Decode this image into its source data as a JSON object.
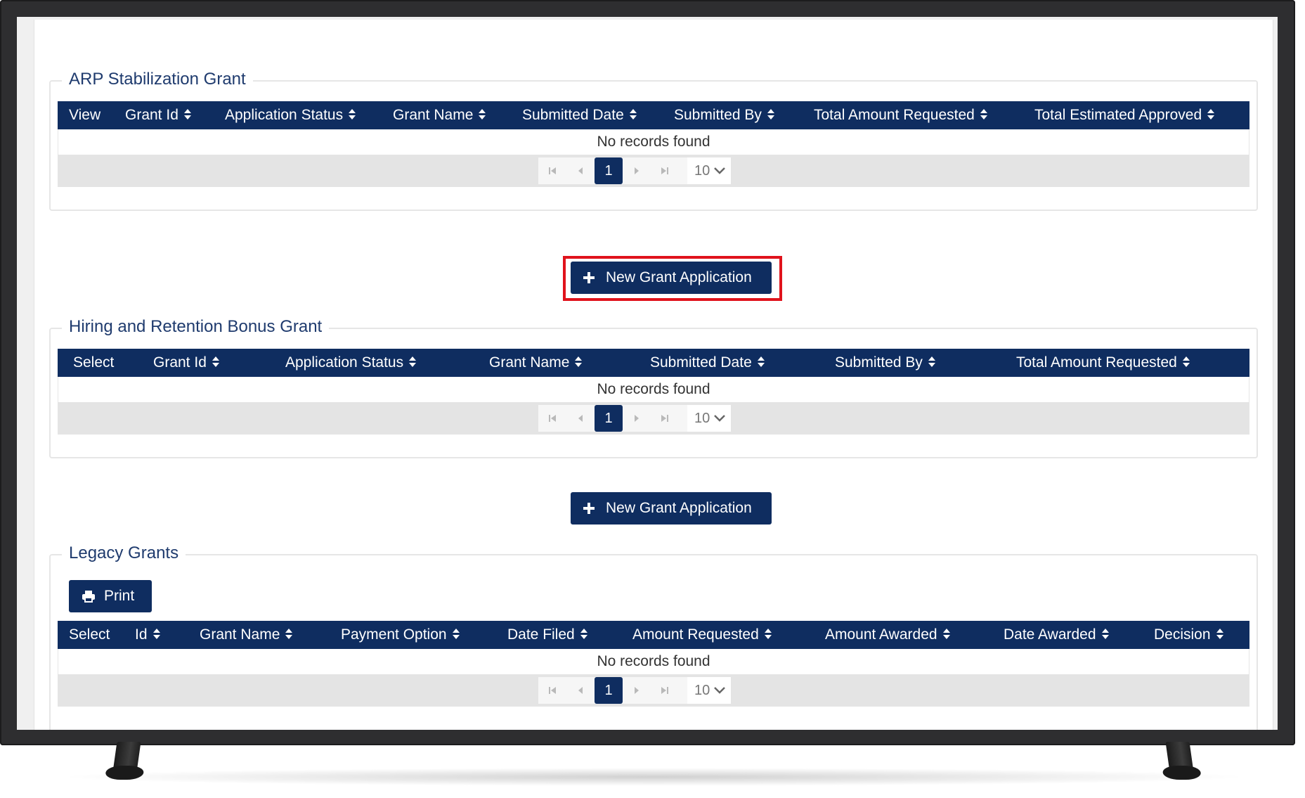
{
  "sections": [
    {
      "legend": "ARP Stabilization Grant",
      "columns": [
        "View",
        "Grant Id",
        "Application Status",
        "Grant Name",
        "Submitted Date",
        "Submitted By",
        "Total Amount Requested",
        "Total Estimated Approved"
      ],
      "empty_text": "No records found",
      "pager": {
        "current_page": "1",
        "page_size": "10"
      },
      "new_button_label": "New Grant Application"
    },
    {
      "legend": "Hiring and Retention Bonus Grant",
      "columns": [
        "Select",
        "Grant Id",
        "Application Status",
        "Grant Name",
        "Submitted Date",
        "Submitted By",
        "Total Amount Requested"
      ],
      "empty_text": "No records found",
      "pager": {
        "current_page": "1",
        "page_size": "10"
      },
      "new_button_label": "New Grant Application"
    },
    {
      "legend": "Legacy Grants",
      "print_label": "Print",
      "columns": [
        "Select",
        "Id",
        "Grant Name",
        "Payment Option",
        "Date Filed",
        "Amount Requested",
        "Amount Awarded",
        "Date Awarded",
        "Decision"
      ],
      "empty_text": "No records found",
      "pager": {
        "current_page": "1",
        "page_size": "10"
      }
    }
  ],
  "colors": {
    "header_bg": "#0f2d60",
    "highlight": "#e0131c",
    "legend_text": "#1f3b6e"
  },
  "icons": [
    "sort-icon",
    "plus-icon",
    "print-icon",
    "first-page-icon",
    "prev-page-icon",
    "next-page-icon",
    "last-page-icon",
    "chevron-down-icon"
  ]
}
